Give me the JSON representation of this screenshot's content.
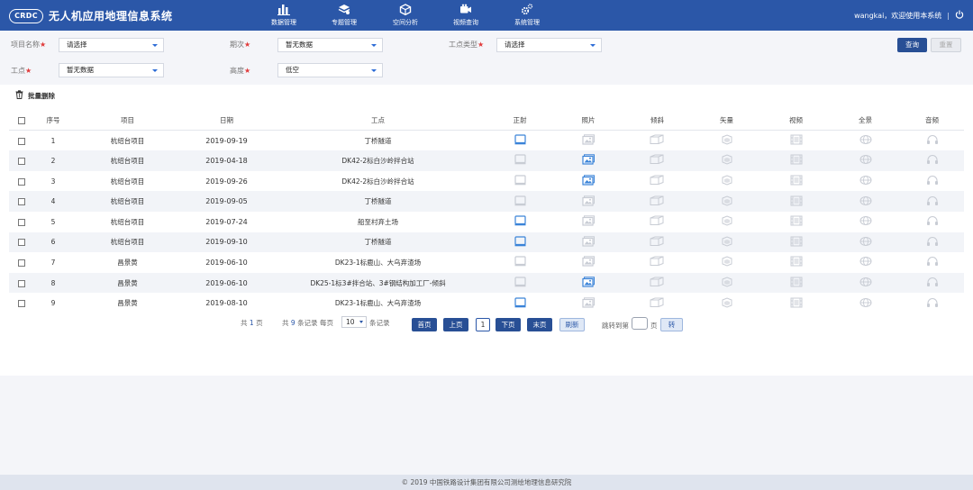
{
  "header": {
    "logo_badge": "CRDC",
    "title": "无人机应用地理信息系统",
    "nav": [
      {
        "label": "数据管理",
        "icon": "bar-chart-icon"
      },
      {
        "label": "专题管理",
        "icon": "layers-icon"
      },
      {
        "label": "空间分析",
        "icon": "cube-icon"
      },
      {
        "label": "视频查询",
        "icon": "video-icon"
      },
      {
        "label": "系统管理",
        "icon": "gears-icon"
      }
    ],
    "user_text": "wangkai，欢迎使用本系统",
    "separator": "|"
  },
  "filters": {
    "project_label": "项目名称",
    "project_value": "请选择",
    "period_label": "期次",
    "period_value": "暂无数据",
    "site_type_label": "工点类型",
    "site_type_value": "请选择",
    "site_label": "工点",
    "site_value": "暂无数据",
    "height_label": "高度",
    "height_value": "低空",
    "required_mark": "★",
    "query_button": "查询",
    "reset_button": "重置"
  },
  "toolbar": {
    "batch_delete": "批量删除"
  },
  "table": {
    "columns": [
      "序号",
      "项目",
      "日期",
      "工点",
      "正射",
      "照片",
      "倾斜",
      "矢量",
      "视频",
      "全景",
      "音频"
    ],
    "rows": [
      {
        "no": "1",
        "project": "杭绍台项目",
        "date": "2019-09-19",
        "site": "丁桥隧道",
        "ortho": true,
        "photo": false
      },
      {
        "no": "2",
        "project": "杭绍台项目",
        "date": "2019-04-18",
        "site": "DK42-2标白沙岭拌合站",
        "ortho": false,
        "photo": true
      },
      {
        "no": "3",
        "project": "杭绍台项目",
        "date": "2019-09-26",
        "site": "DK42-2标白沙岭拌合站",
        "ortho": false,
        "photo": true
      },
      {
        "no": "4",
        "project": "杭绍台项目",
        "date": "2019-09-05",
        "site": "丁桥隧道",
        "ortho": false,
        "photo": false
      },
      {
        "no": "5",
        "project": "杭绍台项目",
        "date": "2019-07-24",
        "site": "船至村弃土场",
        "ortho": true,
        "photo": false
      },
      {
        "no": "6",
        "project": "杭绍台项目",
        "date": "2019-09-10",
        "site": "丁桥隧道",
        "ortho": true,
        "photo": false
      },
      {
        "no": "7",
        "project": "昌景黄",
        "date": "2019-06-10",
        "site": "DK23-1标鹿山、大乌弃渣场",
        "ortho": false,
        "photo": false
      },
      {
        "no": "8",
        "project": "昌景黄",
        "date": "2019-06-10",
        "site": "DK25-1标3#拌合站、3#钢结构加工厂-倾斜",
        "ortho": false,
        "photo": true
      },
      {
        "no": "9",
        "project": "昌景黄",
        "date": "2019-08-10",
        "site": "DK23-1标鹿山、大乌弃渣场",
        "ortho": true,
        "photo": false
      }
    ]
  },
  "pagination": {
    "total_pages_prefix": "共",
    "total_pages": "1",
    "total_pages_suffix": "页",
    "total_records_prefix": "共",
    "total_records": "9",
    "total_records_suffix": "条记录 每页",
    "page_size": "10",
    "page_size_suffix": "条记录",
    "first": "首页",
    "prev": "上页",
    "current": "1",
    "next": "下页",
    "last": "末页",
    "refresh": "刷新",
    "goto_prefix": "跳转到第",
    "goto_suffix": "页",
    "goto_button": "转"
  },
  "footer": {
    "copyright": "© 2019 中国铁路设计集团有限公司测绘地理信息研究院"
  },
  "colors": {
    "header_bg": "#2b57a8",
    "primary_button": "#284f95",
    "active_icon": "#3a83d8",
    "inactive_icon": "#c8ccd4",
    "required": "#e03a3a"
  }
}
